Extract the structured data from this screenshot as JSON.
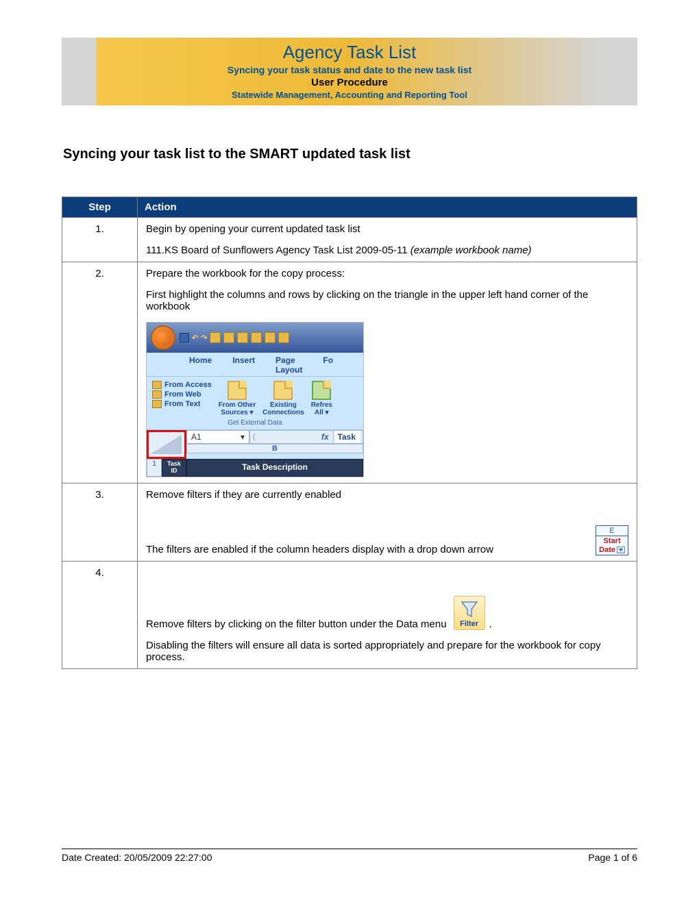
{
  "header": {
    "title": "Agency Task List",
    "subtitle1": "Syncing your task status and date to the new task list",
    "subtitle2": "User Procedure",
    "subtitle3": "Statewide Management, Accounting and Reporting Tool"
  },
  "section_title": "Syncing your task list to the SMART updated task list",
  "table": {
    "headers": {
      "step": "Step",
      "action": "Action"
    },
    "rows": [
      {
        "num": "1.",
        "line1": "Begin by opening your current updated task list",
        "line2_prefix": "111.KS Board of Sunflowers Agency Task List 2009-05-11  ",
        "line2_italic": "(example workbook name)"
      },
      {
        "num": "2.",
        "line1": "Prepare the workbook for the copy process:",
        "line2": "First highlight the columns and rows by clicking on the triangle in the upper left hand corner of the workbook",
        "excel": {
          "tabs": {
            "home": "Home",
            "insert": "Insert",
            "layout": "Page Layout",
            "fo": "Fo"
          },
          "src": {
            "access": "From Access",
            "web": "From Web",
            "text": "From Text",
            "other": "From Other Sources",
            "existing": "Existing Connections",
            "refresh": "Refres",
            "all": "All"
          },
          "group_label": "Get External Data",
          "namebox": "A1",
          "fx": "fx",
          "fx_val": "Task",
          "col_b": "B",
          "row1": "1",
          "task_id": "Task ID",
          "task_desc": "Task Description"
        }
      },
      {
        "num": "3.",
        "line1": "Remove filters if they are currently enabled",
        "line2": "The filters are enabled if the column headers display with a drop down arrow",
        "pill": {
          "e": "E",
          "start": "Start",
          "date": "Date"
        }
      },
      {
        "num": "4.",
        "line1": "Remove filters by clicking on the filter button under the Data menu",
        "line2": "Disabling the filters will ensure all data is sorted appropriately and prepare for the workbook for copy process.",
        "filter_label": "Filter"
      }
    ]
  },
  "footer": {
    "left": "Date Created: 20/05/2009 22:27:00",
    "right": "Page 1 of 6"
  }
}
